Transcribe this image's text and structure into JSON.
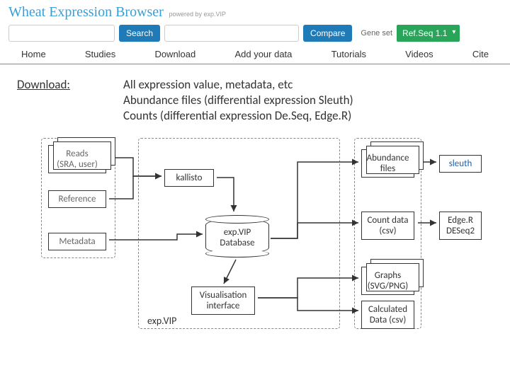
{
  "brand": {
    "title": "Wheat Expression Browser",
    "subtitle": "powered by exp.VIP"
  },
  "searchbar": {
    "search_placeholder": "",
    "search_btn": "Search",
    "compare_placeholder": "",
    "compare_btn": "Compare",
    "gene_set_label": "Gene set",
    "refseq_label": "Ref.Seq 1.1"
  },
  "nav": {
    "home": "Home",
    "studies": "Studies",
    "download": "Download",
    "addyour": "Add your data",
    "tutorials": "Tutorials",
    "videos": "Videos",
    "cite": "Cite"
  },
  "download": {
    "label": "Download:",
    "line1": "All expression value, metadata, etc",
    "line2": "Abundance files (differential expression Sleuth)",
    "line3": "Counts (differential expression De.Seq, Edge.R)"
  },
  "diagram": {
    "reads": "Reads\n(SRA, user)",
    "reference": "Reference",
    "metadata": "Metadata",
    "kallisto": "kallisto",
    "db": "exp.VIP\nDatabase",
    "vis": "Visualisation\ninterface",
    "vip_label": "exp.VIP",
    "abundance": "Abundance\nfiles",
    "count": "Count data\n(csv)",
    "graphs": "Graphs\n(SVG/PNG)",
    "calc": "Calculated\nData (csv)",
    "sleuth": "sleuth",
    "edge": "Edge.R\nDESeq2"
  }
}
